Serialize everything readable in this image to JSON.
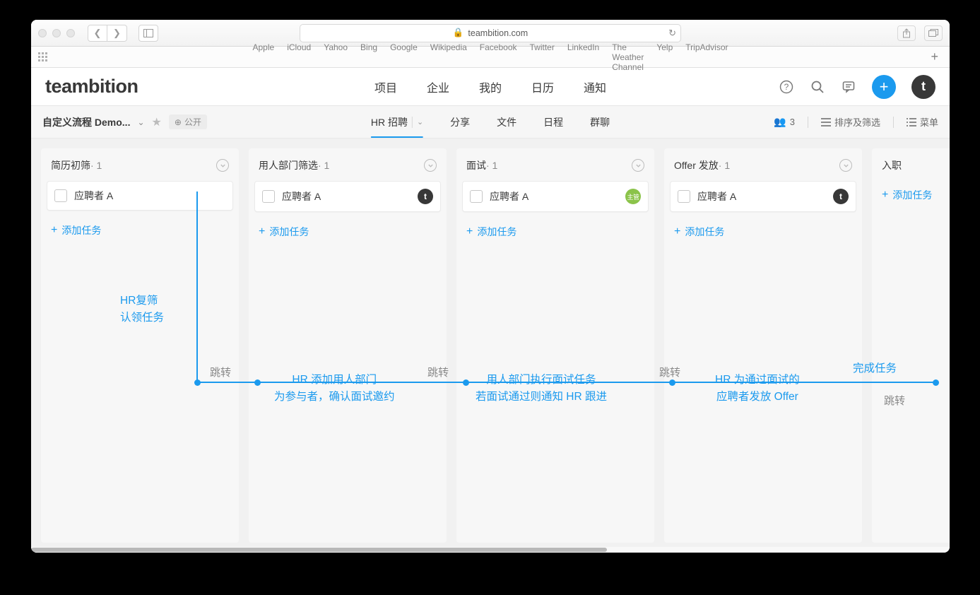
{
  "browser": {
    "url_host": "teambition.com",
    "favorites": [
      "Apple",
      "iCloud",
      "Yahoo",
      "Bing",
      "Google",
      "Wikipedia",
      "Facebook",
      "Twitter",
      "LinkedIn",
      "The Weather Channel",
      "Yelp",
      "TripAdvisor"
    ]
  },
  "header": {
    "logo": "teambition",
    "nav": [
      "项目",
      "企业",
      "我的",
      "日历",
      "通知"
    ],
    "avatar_letter": "t"
  },
  "sub": {
    "project_name": "自定义流程 Demo...",
    "visibility": "公开",
    "tabs": [
      "HR 招聘",
      "分享",
      "文件",
      "日程",
      "群聊"
    ],
    "active_tab": 0,
    "member_count": "3",
    "sort_label": "排序及筛选",
    "menu_label": "菜单"
  },
  "board": {
    "add_task_label": "添加任务",
    "columns": [
      {
        "title": "简历初筛",
        "count": "1",
        "card_text": "应聘者 A",
        "card_deco": "none"
      },
      {
        "title": "用人部门筛选",
        "count": "1",
        "card_text": "应聘者 A",
        "card_deco": "avatar"
      },
      {
        "title": "面试",
        "count": "1",
        "card_text": "应聘者 A",
        "card_deco": "badge",
        "badge_text": "主管"
      },
      {
        "title": "Offer 发放",
        "count": "1",
        "card_text": "应聘者 A",
        "card_deco": "avatar"
      },
      {
        "title": "入职",
        "count": "",
        "card_text": "",
        "card_deco": "none",
        "partial": true
      }
    ]
  },
  "anno": {
    "a1_l1": "HR复筛",
    "a1_l2": "认领任务",
    "jump": "跳转",
    "a2_l1": "HR 添加用人部门",
    "a2_l2": "为参与者，确认面试邀约",
    "a3_l1": "用人部门执行面试任务",
    "a3_l2": "若面试通过则通知 HR 跟进",
    "a4_l1": "HR 为通过面试的",
    "a4_l2": "应聘者发放 Offer",
    "done": "完成任务"
  }
}
